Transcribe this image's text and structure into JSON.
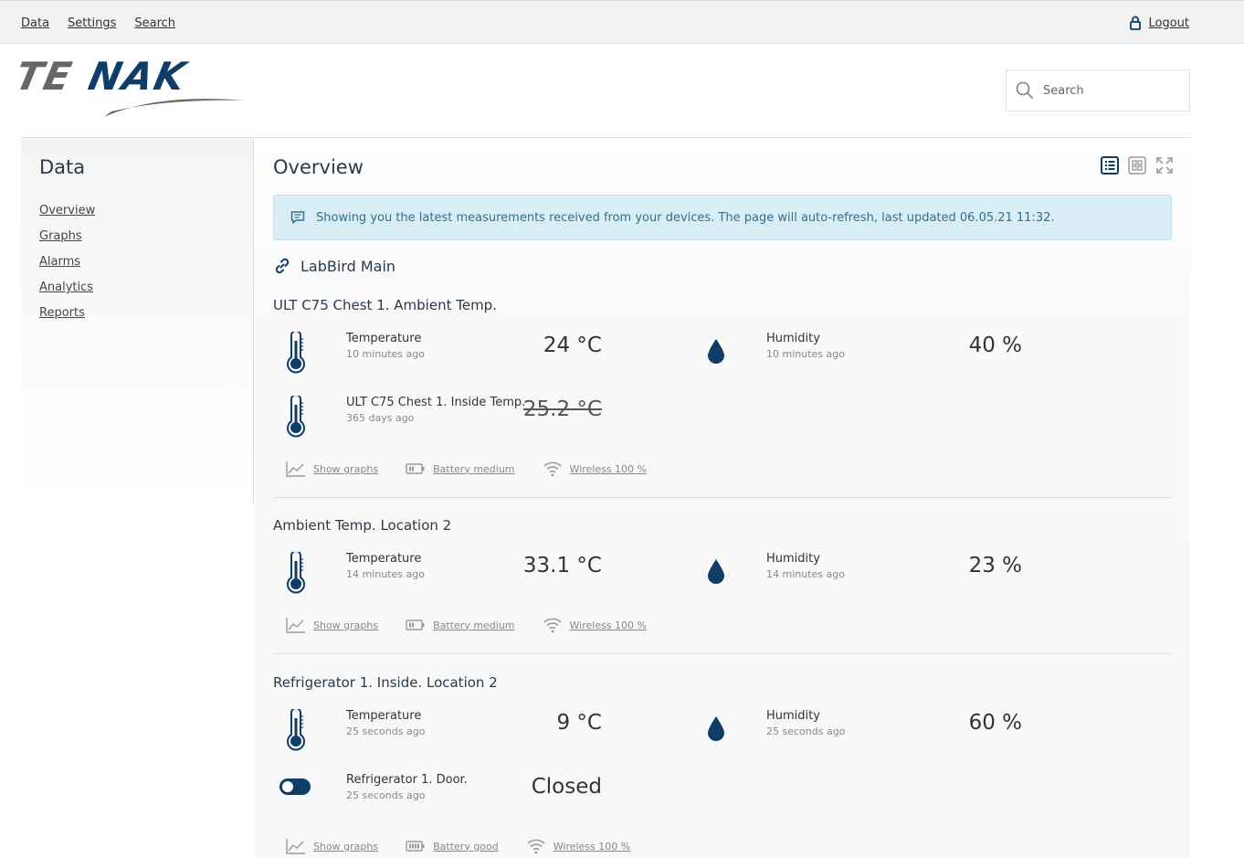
{
  "topnav": {
    "items": [
      "Data",
      "Settings",
      "Search"
    ],
    "logout": "Logout"
  },
  "logo": {
    "text": "TENAK"
  },
  "search": {
    "placeholder": "Search"
  },
  "sidebar": {
    "title": "Data",
    "items": [
      "Overview",
      "Graphs",
      "Alarms",
      "Analytics",
      "Reports"
    ]
  },
  "main": {
    "title": "Overview",
    "info": "Showing you the latest measurements received from your devices. The page will auto-refresh, last updated 06.05.21 11:32.",
    "group": "LabBird Main"
  },
  "devices": [
    {
      "name": "ULT C75 Chest 1. Ambient Temp.",
      "rows": [
        {
          "label": "Temperature",
          "ago": "10 minutes ago",
          "value": "24 °C",
          "label2": "Humidity",
          "ago2": "10 minutes ago",
          "value2": "40 %"
        },
        {
          "label": "ULT C75 Chest 1. Inside Temp.",
          "ago": "365 days ago",
          "value": "25.2 °C"
        }
      ],
      "footer": {
        "graphs": "Show graphs",
        "battery": "Battery medium",
        "wireless": "Wireless 100 %"
      }
    },
    {
      "name": "Ambient Temp. Location 2",
      "rows": [
        {
          "label": "Temperature",
          "ago": "14 minutes ago",
          "value": "33.1 °C",
          "label2": "Humidity",
          "ago2": "14 minutes ago",
          "value2": "23 %"
        }
      ],
      "footer": {
        "graphs": "Show graphs",
        "battery": "Battery medium",
        "wireless": "Wireless 100 %"
      }
    },
    {
      "name": "Refrigerator 1. Inside. Location 2",
      "rows": [
        {
          "label": "Temperature",
          "ago": "25 seconds ago",
          "value": "9 °C",
          "label2": "Humidity",
          "ago2": "25 seconds ago",
          "value2": "60 %"
        },
        {
          "label": "Refrigerator 1. Door.",
          "ago": "25 seconds ago",
          "value": "Closed"
        }
      ],
      "footer": {
        "graphs": "Show graphs",
        "battery": "Battery good",
        "wireless": "Wireless 100 %"
      }
    }
  ],
  "colors": {
    "accent": "#0f3d68",
    "info_bg": "#d9edf5",
    "info_text": "#31708f"
  },
  "icons": [
    "lock-icon",
    "search-icon",
    "list-view-icon",
    "grid-view-icon",
    "fullscreen-icon",
    "chat-icon",
    "link-icon",
    "thermometer-icon",
    "droplet-icon",
    "toggle-icon",
    "chart-icon",
    "battery-icon",
    "wifi-icon"
  ]
}
